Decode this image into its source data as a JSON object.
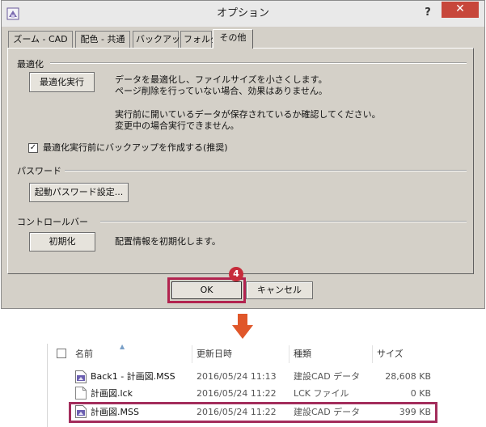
{
  "dialog": {
    "title": "オプション",
    "help_label": "?",
    "close_label": "✕",
    "tabs": [
      {
        "label": "ズーム - CAD"
      },
      {
        "label": "配色 - 共通"
      },
      {
        "label": "バックアップ"
      },
      {
        "label": "フォルダ"
      },
      {
        "label": "その他"
      }
    ],
    "active_tab": "その他",
    "optimize": {
      "section_label": "最適化",
      "button_label": "最適化実行",
      "desc_line1": "データを最適化し、ファイルサイズを小さくします。",
      "desc_line2": "ページ削除を行っていない場合、効果はありません。",
      "desc_line3": "実行前に開いているデータが保存されているか確認してください。",
      "desc_line4": "変更中の場合実行できません。",
      "checkbox_label": "最適化実行前にバックアップを作成する(推奨)",
      "checkbox_checked": true,
      "checkbox_mark": "✓"
    },
    "password": {
      "section_label": "パスワード",
      "button_label": "起動パスワード設定..."
    },
    "controlbar": {
      "section_label": "コントロールバー",
      "button_label": "初期化",
      "desc": "配置情報を初期化します。"
    },
    "ok_label": "OK",
    "cancel_label": "キャンセル",
    "step_badge": "4"
  },
  "explorer": {
    "columns": {
      "name": "名前",
      "date": "更新日時",
      "type": "種類",
      "size": "サイズ"
    },
    "files": [
      {
        "name": "Back1 - 計画図.MSS",
        "date": "2016/05/24 11:13",
        "type": "建設CAD データ",
        "size": "28,608 KB",
        "icon": "mss-file-icon"
      },
      {
        "name": "計画図.lck",
        "date": "2016/05/24 11:22",
        "type": "LCK ファイル",
        "size": "0 KB",
        "icon": "blank-file-icon"
      },
      {
        "name": "計画図.MSS",
        "date": "2016/05/24 11:22",
        "type": "建設CAD データ",
        "size": "399 KB",
        "icon": "mss-file-icon"
      }
    ]
  },
  "colors": {
    "highlight": "#b2234f",
    "badge": "#c62b3a",
    "arrow": "#e0572a",
    "close_button": "#c7473b"
  }
}
